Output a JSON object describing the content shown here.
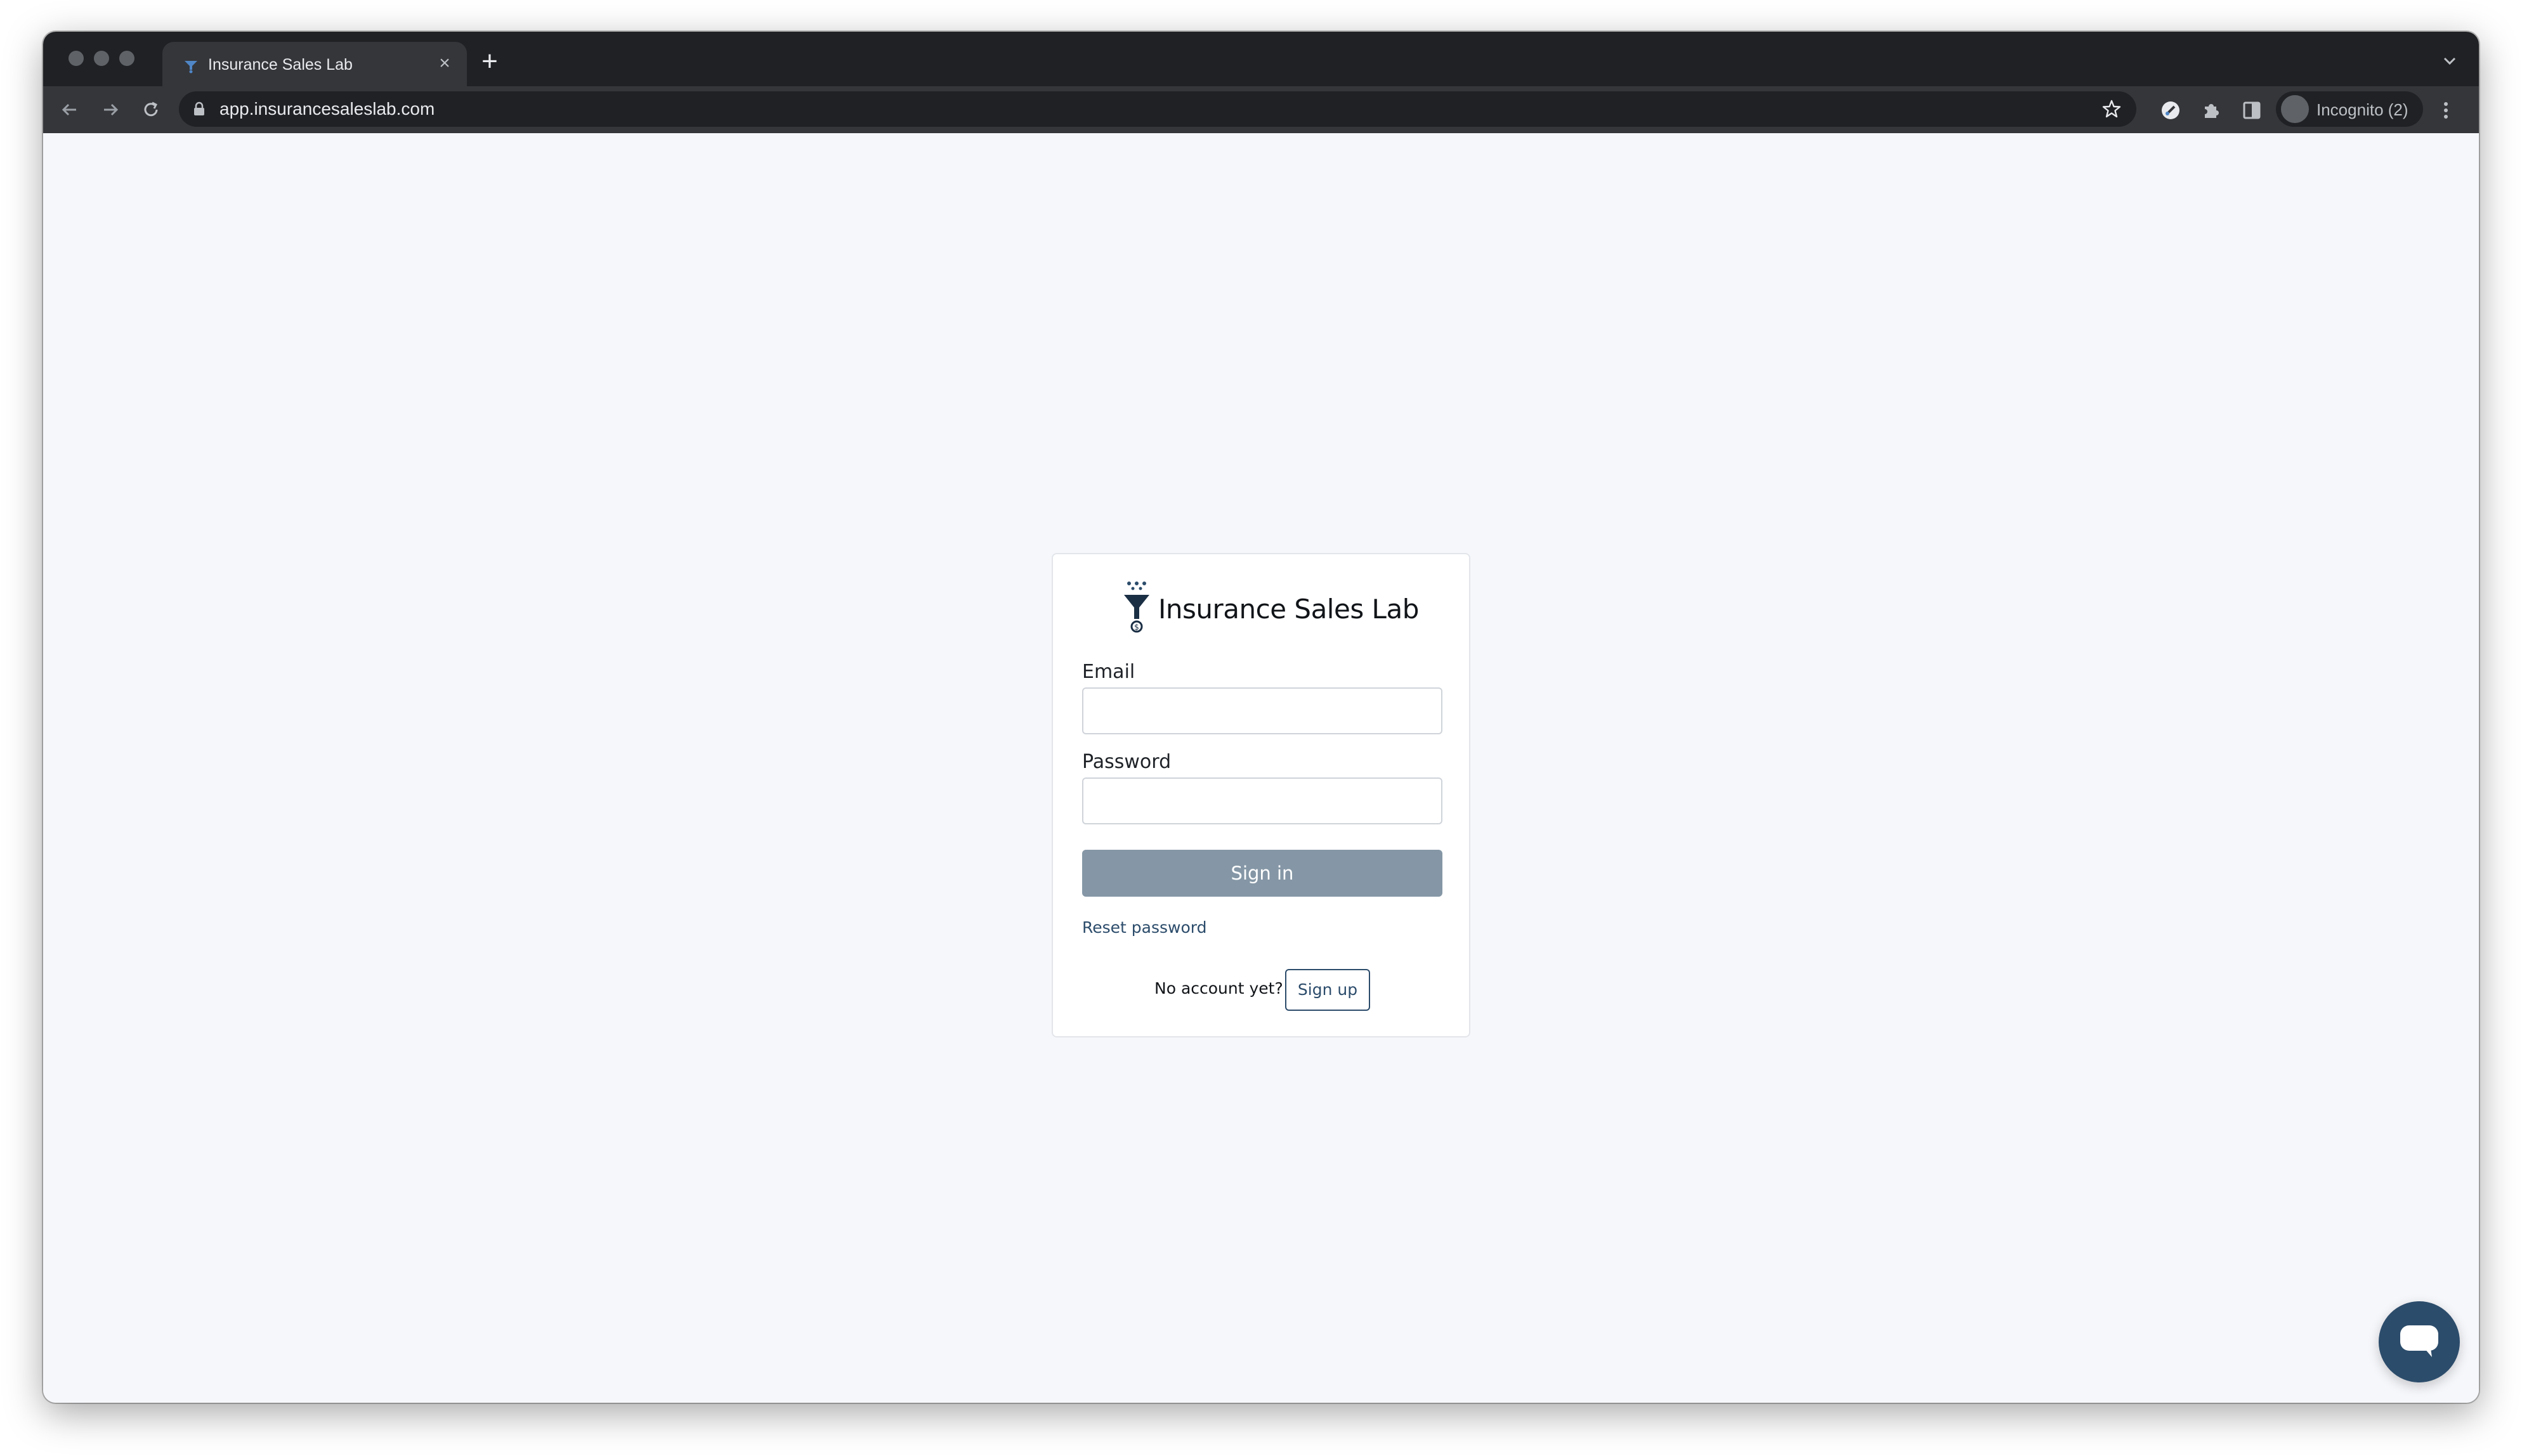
{
  "browser": {
    "tab_title": "Insurance Sales Lab",
    "tab_close": "×",
    "new_tab": "+",
    "url": "app.insurancesaleslab.com",
    "profile_label": "Incognito (2)"
  },
  "login": {
    "brand_name": "Insurance Sales Lab",
    "email_label": "Email",
    "email_value": "",
    "password_label": "Password",
    "password_value": "",
    "signin_label": "Sign in",
    "reset_label": "Reset password",
    "no_account_text": "No account yet?",
    "signup_label": "Sign up"
  },
  "colors": {
    "brand": "#2c4c6b",
    "signin_disabled": "#8597a6",
    "page_background": "#f6f7fb"
  },
  "icons": {
    "back": "arrow-left-icon",
    "forward": "arrow-right-icon",
    "reload": "reload-icon",
    "lock": "lock-icon",
    "bookmark": "star-icon",
    "extension1": "eyedropper-icon",
    "extensions": "puzzle-icon",
    "side_panel": "side-panel-icon",
    "menu": "kebab-icon",
    "chat": "chat-bubble-icon"
  }
}
